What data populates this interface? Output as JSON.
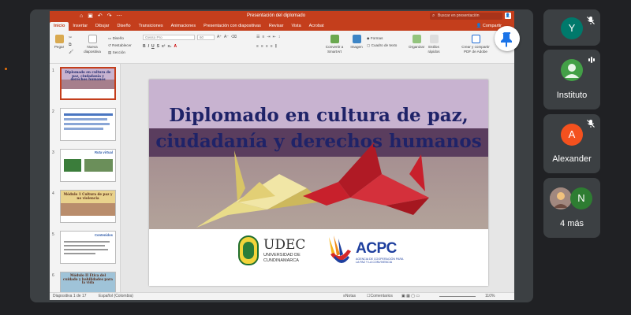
{
  "powerpoint": {
    "document_title": "Presentación del diplomado",
    "search_placeholder": "Buscar en presentación",
    "tabs": [
      "Inicio",
      "Insertar",
      "Dibujar",
      "Diseño",
      "Transiciones",
      "Animaciones",
      "Presentación con diapositivas",
      "Revisar",
      "Vista",
      "Acrobat"
    ],
    "share_label": "Compartir",
    "ribbon": {
      "paste": "Pegar",
      "new_slide": "Nueva diapositiva",
      "layout": "Diseño",
      "reset": "Restablecer",
      "section": "Sección",
      "font_name": "Gesso Pro",
      "font_size": "60",
      "convert_smartart": "Convertir a SmartArt",
      "image": "Imagen",
      "shapes": "Formas",
      "textbox": "Cuadro de texto",
      "arrange": "Organizar",
      "quick_styles": "Estilos rápidos",
      "create_pdf": "Crear y compartir PDF de Adobe"
    },
    "thumbnails": [
      {
        "num": "1",
        "text": "Diplomado en cultura de paz, ciudadanía y derechos humanos"
      },
      {
        "num": "2",
        "text": ""
      },
      {
        "num": "3",
        "text": "Ruta virtual"
      },
      {
        "num": "4",
        "text": "Módulo 1 Cultura de paz y no violencia"
      },
      {
        "num": "5",
        "text": "Contenidos"
      },
      {
        "num": "6",
        "text": "Módulo II Ética del cuidado y habilidades para la vida"
      }
    ],
    "slide": {
      "title_line1": "Diplomado en cultura de paz,",
      "title_line2": "ciudadanía y derechos humanos",
      "udec_name": "UDEC",
      "udec_sub1": "UNIVERSIDAD DE",
      "udec_sub2": "CUNDINAMARCA",
      "acpc_name": "ACPC",
      "acpc_sub1": "AGENCIA DE COOPERACIÓN PARA",
      "acpc_sub2": "LA PAZ Y LA CONVIVENCIA"
    },
    "status": {
      "slide_counter": "Diapositiva 1 de 17",
      "language": "Español (Colombia)",
      "notes": "Notas",
      "comments": "Comentarios",
      "zoom": "110%"
    }
  },
  "participants": [
    {
      "initial": "Y",
      "name": "",
      "color": "#00796b",
      "muted": true
    },
    {
      "initial": "",
      "name": "Instituto",
      "color": "#43a047",
      "muted": false,
      "speaking": true
    },
    {
      "initial": "A",
      "name": "Alexander",
      "color": "#f4511e",
      "muted": true
    },
    {
      "initial": "N",
      "name": "4 más",
      "color": "#2e7d32",
      "muted": false
    }
  ]
}
